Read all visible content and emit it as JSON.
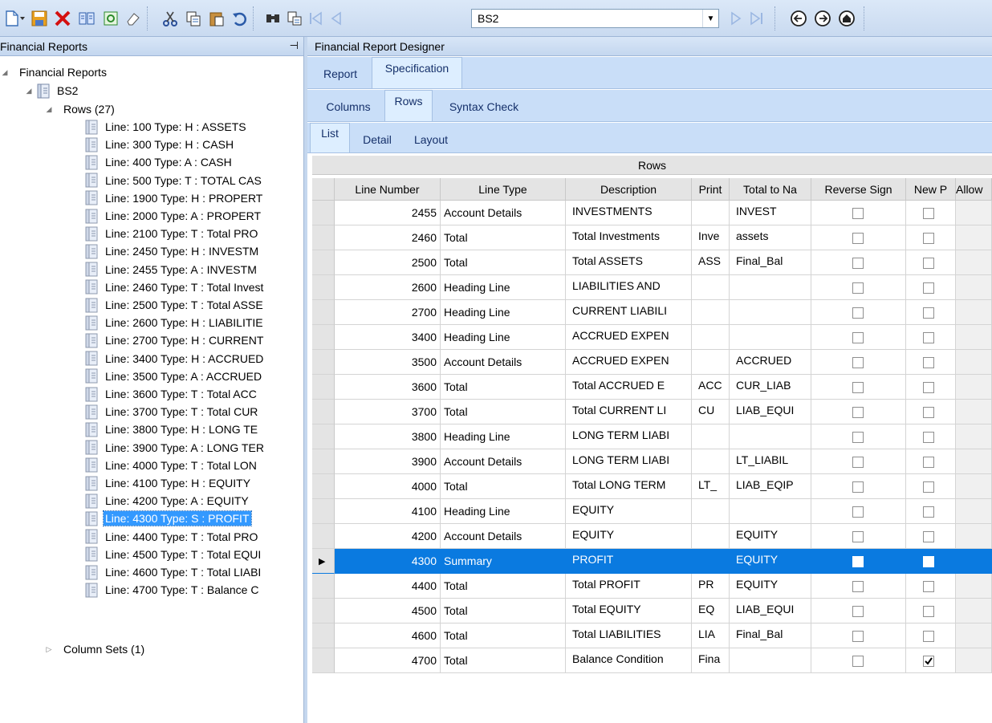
{
  "toolbar": {
    "report_selector_value": "BS2",
    "icons": [
      "new-icon",
      "save-icon",
      "delete-icon",
      "book-icon",
      "refresh-icon",
      "eraser-icon",
      "cut-icon",
      "copy-icon",
      "paste-icon",
      "undo-icon",
      "find-icon",
      "find-replace-icon",
      "first-record-icon",
      "previous-record-icon",
      "next-record-icon",
      "last-record-icon",
      "back-icon",
      "forward-icon",
      "home-icon"
    ]
  },
  "left_panel": {
    "title": "Financial Reports",
    "pin_glyph": "⊣",
    "tree": {
      "root": "Financial Reports",
      "report": "BS2",
      "rows_node": "Rows (27)",
      "column_sets_node": "Column Sets (1)",
      "rows": [
        "Line: 100 Type: H : ASSETS",
        "Line: 300 Type: H : CASH",
        "Line: 400 Type: A : CASH",
        "Line: 500 Type: T : TOTAL CAS",
        "Line: 1900 Type: H : PROPERT",
        "Line: 2000 Type: A : PROPERT",
        "Line: 2100 Type: T : Total PRO",
        "Line: 2450 Type: H : INVESTM",
        "Line: 2455 Type: A : INVESTM",
        "Line: 2460 Type: T : Total Invest",
        "Line: 2500 Type: T : Total ASSE",
        "Line: 2600 Type: H : LIABILITIE",
        "Line: 2700 Type: H : CURRENT",
        "Line: 3400 Type: H : ACCRUED",
        "Line: 3500 Type: A : ACCRUED",
        "Line: 3600 Type: T : Total ACC",
        "Line: 3700 Type: T : Total CUR",
        "Line: 3800 Type: H : LONG TE",
        "Line: 3900 Type: A : LONG TER",
        "Line: 4000 Type: T : Total LON",
        "Line: 4100 Type: H : EQUITY",
        "Line: 4200 Type: A : EQUITY",
        "Line: 4300 Type: S : PROFIT",
        "Line: 4400 Type: T : Total PRO",
        "Line: 4500 Type: T : Total EQUI",
        "Line: 4600 Type: T : Total LIABI",
        "Line: 4700 Type: T : Balance C"
      ],
      "selected_row": "Line: 4300 Type: S : PROFIT"
    }
  },
  "designer": {
    "title": "Financial Report Designer",
    "tabs_level1": [
      "Report",
      "Specification"
    ],
    "tabs_level2": [
      "Columns",
      "Rows",
      "Syntax Check"
    ],
    "tabs_level3": [
      "List",
      "Detail",
      "Layout"
    ],
    "active": {
      "level1": "Specification",
      "level2": "Rows",
      "level3": "List"
    },
    "grid": {
      "title": "Rows",
      "columns": [
        "Line Number",
        "Line Type",
        "Description",
        "Print",
        "Total to Na",
        "Reverse Sign",
        "New P",
        "Allow"
      ],
      "rows": [
        {
          "line": "2455",
          "type": "Account Details",
          "desc": "INVESTMENTS",
          "print": "",
          "total": "INVEST",
          "reverse": false,
          "newp": false
        },
        {
          "line": "2460",
          "type": "Total",
          "desc": "Total Investments",
          "print": "Inve",
          "total": "assets",
          "reverse": false,
          "newp": false
        },
        {
          "line": "2500",
          "type": "Total",
          "desc": "Total ASSETS",
          "print": "ASS",
          "total": "Final_Bal",
          "reverse": false,
          "newp": false
        },
        {
          "line": "2600",
          "type": "Heading Line",
          "desc": "LIABILITIES AND",
          "print": "",
          "total": "",
          "reverse": false,
          "newp": false
        },
        {
          "line": "2700",
          "type": "Heading Line",
          "desc": "CURRENT LIABILI",
          "print": "",
          "total": "",
          "reverse": false,
          "newp": false
        },
        {
          "line": "3400",
          "type": "Heading Line",
          "desc": "ACCRUED EXPEN",
          "print": "",
          "total": "",
          "reverse": false,
          "newp": false
        },
        {
          "line": "3500",
          "type": "Account Details",
          "desc": "ACCRUED EXPEN",
          "print": "",
          "total": "ACCRUED",
          "reverse": false,
          "newp": false
        },
        {
          "line": "3600",
          "type": "Total",
          "desc": "Total ACCRUED E",
          "print": "ACC",
          "total": "CUR_LIAB",
          "reverse": false,
          "newp": false
        },
        {
          "line": "3700",
          "type": "Total",
          "desc": "Total CURRENT LI",
          "print": "CU",
          "total": "LIAB_EQUI",
          "reverse": false,
          "newp": false
        },
        {
          "line": "3800",
          "type": "Heading Line",
          "desc": "LONG TERM LIABI",
          "print": "",
          "total": "",
          "reverse": false,
          "newp": false
        },
        {
          "line": "3900",
          "type": "Account Details",
          "desc": "LONG TERM LIABI",
          "print": "",
          "total": "LT_LIABIL",
          "reverse": false,
          "newp": false
        },
        {
          "line": "4000",
          "type": "Total",
          "desc": "Total LONG TERM",
          "print": "LT_",
          "total": "LIAB_EQIP",
          "reverse": false,
          "newp": false
        },
        {
          "line": "4100",
          "type": "Heading Line",
          "desc": "EQUITY",
          "print": "",
          "total": "",
          "reverse": false,
          "newp": false
        },
        {
          "line": "4200",
          "type": "Account Details",
          "desc": "EQUITY",
          "print": "",
          "total": "EQUITY",
          "reverse": false,
          "newp": false
        },
        {
          "line": "4300",
          "type": "Summary",
          "desc": "PROFIT",
          "print": "",
          "total": "EQUITY",
          "reverse": false,
          "newp": false,
          "selected": true
        },
        {
          "line": "4400",
          "type": "Total",
          "desc": "Total PROFIT",
          "print": "PR",
          "total": "EQUITY",
          "reverse": false,
          "newp": false
        },
        {
          "line": "4500",
          "type": "Total",
          "desc": "Total EQUITY",
          "print": "EQ",
          "total": "LIAB_EQUI",
          "reverse": false,
          "newp": false
        },
        {
          "line": "4600",
          "type": "Total",
          "desc": "Total LIABILITIES",
          "print": "LIA",
          "total": "Final_Bal",
          "reverse": false,
          "newp": false
        },
        {
          "line": "4700",
          "type": "Total",
          "desc": "Balance Condition",
          "print": "Fina",
          "total": "",
          "reverse": false,
          "newp": true
        }
      ]
    }
  },
  "colors": {
    "selection": "#0a7ae0",
    "tree_selection": "#3399ff",
    "tab_strip": "#c9def8",
    "header_gray": "#e4e4e4"
  }
}
